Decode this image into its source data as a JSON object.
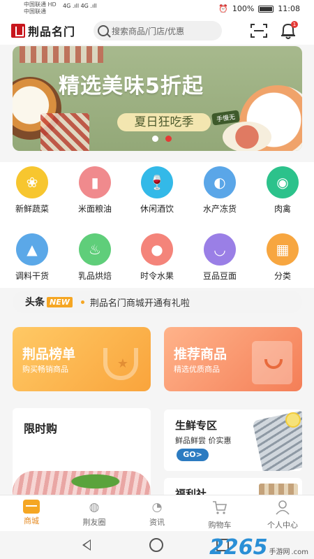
{
  "status_bar": {
    "carrier_1": "中国联通 HD",
    "carrier_2": "中国联通",
    "signal": "4G .ıll 4G .ıll",
    "alarm": "⏰",
    "battery_pct": "100%",
    "time": "11:08"
  },
  "header": {
    "logo_text": "荆品名门",
    "search_placeholder": "搜索商品/门店/优惠",
    "bell_badge": "1"
  },
  "banner": {
    "title": "精选美味5折起",
    "subtitle": "夏日狂吃季",
    "stamp": "手慢无",
    "slides": 2,
    "active_slide": 2
  },
  "categories": [
    {
      "label": "新鲜蔬菜",
      "icon": "vegetable-icon",
      "color": "#f7c62f",
      "glyph": "❀"
    },
    {
      "label": "米面粮油",
      "icon": "oil-bottle-icon",
      "color": "#f08a8d",
      "glyph": "▮"
    },
    {
      "label": "休闲酒饮",
      "icon": "drink-icon",
      "color": "#33b9e8",
      "glyph": "🍷"
    },
    {
      "label": "水产冻货",
      "icon": "fish-icon",
      "color": "#5aa6e8",
      "glyph": "◐"
    },
    {
      "label": "肉禽",
      "icon": "meat-icon",
      "color": "#2cc28b",
      "glyph": "◉"
    },
    {
      "label": "调料干货",
      "icon": "seasoning-icon",
      "color": "#5ba8e8",
      "glyph": "▲"
    },
    {
      "label": "乳品烘焙",
      "icon": "cake-icon",
      "color": "#5fce7a",
      "glyph": "♨"
    },
    {
      "label": "时令水果",
      "icon": "fruit-icon",
      "color": "#f4847a",
      "glyph": "●"
    },
    {
      "label": "豆品豆面",
      "icon": "noodle-bowl-icon",
      "color": "#9a7fe6",
      "glyph": "◡"
    },
    {
      "label": "分类",
      "icon": "category-grid-icon",
      "color": "#f7a640",
      "glyph": "▦"
    }
  ],
  "news": {
    "tag": "头条",
    "badge": "NEW",
    "text": "荆品名门商城开通有礼啦"
  },
  "promos": [
    {
      "title": "荆品榜单",
      "subtitle": "购买畅销商品"
    },
    {
      "title": "推荐商品",
      "subtitle": "精选优质商品"
    }
  ],
  "sections": {
    "flash_sale_title": "限时购",
    "fresh_title": "生鲜专区",
    "fresh_subtitle": "鲜品鲜尝 价实惠",
    "fresh_button": "GO>",
    "welfare_title": "福利社"
  },
  "tabbar": [
    {
      "label": "商城",
      "icon": "shop-icon",
      "active": true
    },
    {
      "label": "荆友圈",
      "icon": "planet-icon",
      "active": false
    },
    {
      "label": "资讯",
      "icon": "news-bulb-icon",
      "active": false
    },
    {
      "label": "购物车",
      "icon": "cart-icon",
      "active": false
    },
    {
      "label": "个人中心",
      "icon": "user-icon",
      "active": false
    }
  ],
  "watermark": {
    "number": "2265",
    "text": "手游网",
    "domain": ".com"
  },
  "colors": {
    "accent": "#e58a21",
    "brand_red": "#c8161d",
    "badge_red": "#e53935"
  }
}
